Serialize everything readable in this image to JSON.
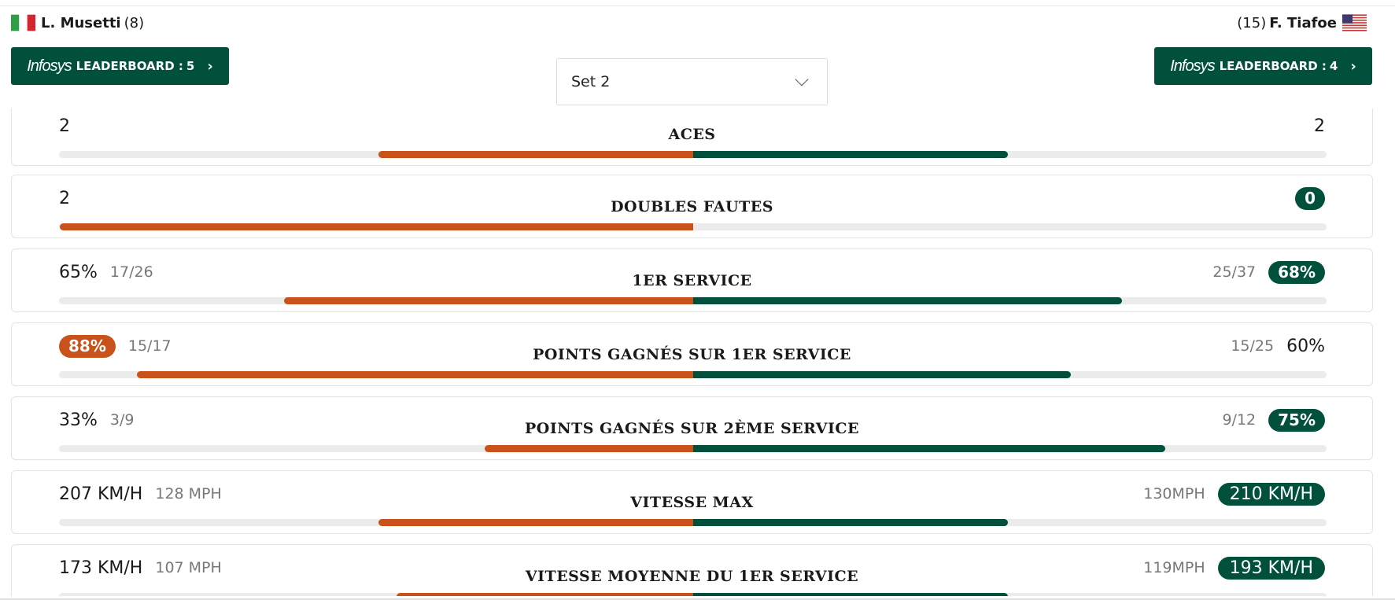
{
  "players": {
    "left": {
      "name": "L. Musetti",
      "seed": "(8)",
      "flag_icon": "italy-flag-icon"
    },
    "right": {
      "name": "F. Tiafoe",
      "seed": "(15)",
      "flag_icon": "usa-flag-icon"
    }
  },
  "leaderboard": {
    "brand": "Infosys",
    "label": "LEADERBOARD :",
    "left_count": "5",
    "right_count": "4",
    "chevron_icon": "chevron-right-icon"
  },
  "set_select": {
    "value": "Set 2",
    "chevron_icon": "chevron-down-icon"
  },
  "colors": {
    "player1": "#c8521a",
    "player2": "#00503c",
    "track": "#ebebeb"
  },
  "stats": [
    {
      "title": "ACES",
      "left": {
        "main": "2",
        "sub": ""
      },
      "right": {
        "main": "2",
        "sub": ""
      },
      "highlight": "none",
      "share_left": 0.5
    },
    {
      "title": "DOUBLES FAUTES",
      "left": {
        "main": "2",
        "sub": ""
      },
      "right": {
        "main": "0",
        "sub": ""
      },
      "highlight": "right",
      "share_left": 1.0
    },
    {
      "title": "1ER SERVICE",
      "left": {
        "main": "65%",
        "sub": "17/26"
      },
      "right": {
        "main": "68%",
        "sub": "25/37"
      },
      "highlight": "right",
      "share_left": 0.49
    },
    {
      "title": "POINTS GAGNÉS SUR 1ER SERVICE",
      "left": {
        "main": "88%",
        "sub": "15/17"
      },
      "right": {
        "main": "60%",
        "sub": "15/25"
      },
      "highlight": "left",
      "share_left": 0.595
    },
    {
      "title": "POINTS GAGNÉS SUR 2ÈME SERVICE",
      "left": {
        "main": "33%",
        "sub": "3/9"
      },
      "right": {
        "main": "75%",
        "sub": "9/12"
      },
      "highlight": "right",
      "share_left": 0.31
    },
    {
      "title": "VITESSE MAX",
      "left": {
        "main": "207 KM/H",
        "sub": "128 MPH"
      },
      "right": {
        "main": "210 KM/H",
        "sub": "130MPH"
      },
      "highlight": "right",
      "share_left": 0.5
    },
    {
      "title": "VITESSE MOYENNE DU 1ER SERVICE",
      "left": {
        "main": "173 KM/H",
        "sub": "107 MPH"
      },
      "right": {
        "main": "193 KM/H",
        "sub": "119MPH"
      },
      "highlight": "right",
      "share_left": 0.47
    }
  ]
}
